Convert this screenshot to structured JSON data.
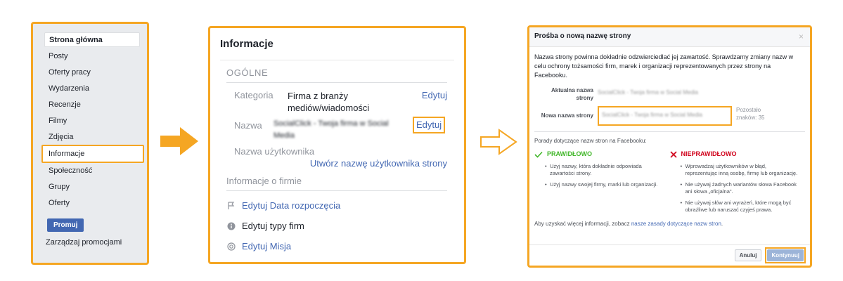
{
  "panel1": {
    "items": [
      "Strona główna",
      "Posty",
      "Oferty pracy",
      "Wydarzenia",
      "Recenzje",
      "Filmy",
      "Zdjęcia",
      "Informacje",
      "Społeczność",
      "Grupy",
      "Oferty"
    ],
    "promote_label": "Promuj",
    "manage_label": "Zarządzaj promocjami"
  },
  "panel2": {
    "title": "Informacje",
    "general_heading": "OGÓLNE",
    "category_label": "Kategoria",
    "category_value": "Firma z branży mediów/wiadomości",
    "edit_label": "Edytuj",
    "name_label": "Nazwa",
    "name_value": "SocialClick - Twoja firma w Social Media",
    "username_label": "Nazwa użytkownika",
    "create_username_link": "Utwórz nazwę użytkownika strony",
    "company_heading": "Informacje o firmie",
    "action_start_date": "Edytuj Data rozpoczęcia",
    "action_company_types": "Edytuj typy firm",
    "action_mission": "Edytuj Misja"
  },
  "panel3": {
    "title": "Prośba o nową nazwę strony",
    "close": "×",
    "intro": "Nazwa strony powinna dokładnie odzwierciedlać jej zawartość. Sprawdzamy zmiany nazw w celu ochrony tożsamości firm, marek i organizacji reprezentowanych przez strony na Facebooku.",
    "current_name_label": "Aktualna nazwa strony",
    "current_name_value": "SocialClick - Twoja firma w Social Media",
    "new_name_label": "Nowa nazwa strony",
    "new_name_value": "SocialClick - Twoja firma w Social Media",
    "remaining_label": "Pozostało znaków:",
    "remaining_value": "35",
    "tips_heading": "Porady dotyczące nazw stron na Facebooku:",
    "correct_heading": "PRAWIDŁOWO",
    "correct_items": [
      "Użyj nazwy, która dokładnie odpowiada zawartości strony.",
      "Użyj nazwy swojej firmy, marki lub organizacji."
    ],
    "incorrect_heading": "NIEPRAWIDŁOWO",
    "incorrect_items": [
      "Wprowadzaj użytkowników w błąd, reprezentując inną osobę, firmę lub organizację.",
      "Nie używaj żadnych wariantów słowa Facebook ani słowa „oficjalna\".",
      "Nie używaj słów ani wyrażeń, które mogą być obraźliwe lub naruszać czyjeś prawa."
    ],
    "more_info_prefix": "Aby uzyskać więcej informacji, zobacz",
    "more_info_link": "nasze zasady dotyczące nazw stron",
    "cancel_label": "Anuluj",
    "continue_label": "Kontynuuj"
  },
  "colors": {
    "highlight": "#f5a623",
    "facebook_blue": "#4267b2",
    "ok_green": "#42b72a",
    "bad_red": "#d0021b"
  }
}
